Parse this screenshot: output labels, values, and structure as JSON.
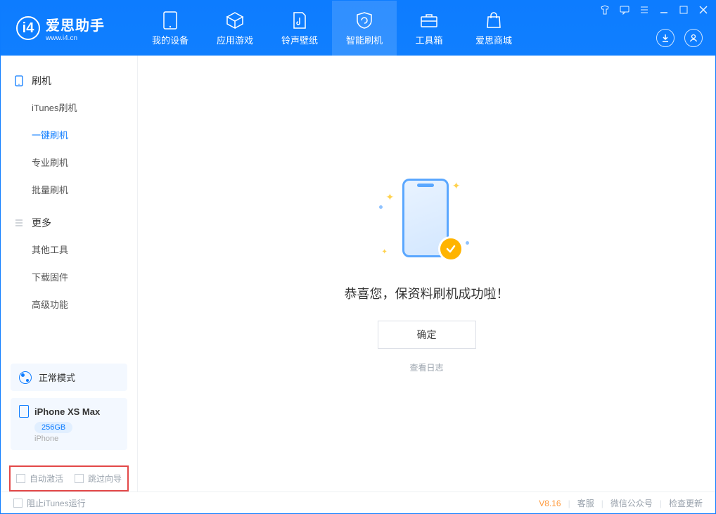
{
  "brand": {
    "title": "爱思助手",
    "sub": "www.i4.cn"
  },
  "nav": {
    "device": "我的设备",
    "apps": "应用游戏",
    "ring": "铃声壁纸",
    "flash": "智能刷机",
    "tools": "工具箱",
    "store": "爱思商城"
  },
  "sidebar": {
    "group1_title": "刷机",
    "items1": {
      "itunes": "iTunes刷机",
      "onekey": "一键刷机",
      "pro": "专业刷机",
      "batch": "批量刷机"
    },
    "group2_title": "更多",
    "items2": {
      "other": "其他工具",
      "firmware": "下载固件",
      "advanced": "高级功能"
    }
  },
  "mode_label": "正常模式",
  "device": {
    "name": "iPhone XS Max",
    "storage": "256GB",
    "type": "iPhone"
  },
  "options": {
    "auto_activate": "自动激活",
    "skip_guide": "跳过向导"
  },
  "main": {
    "success": "恭喜您，保资料刷机成功啦！",
    "ok": "确定",
    "log": "查看日志"
  },
  "footer": {
    "block_itunes": "阻止iTunes运行",
    "version": "V8.16",
    "service": "客服",
    "wechat": "微信公众号",
    "update": "检查更新"
  }
}
